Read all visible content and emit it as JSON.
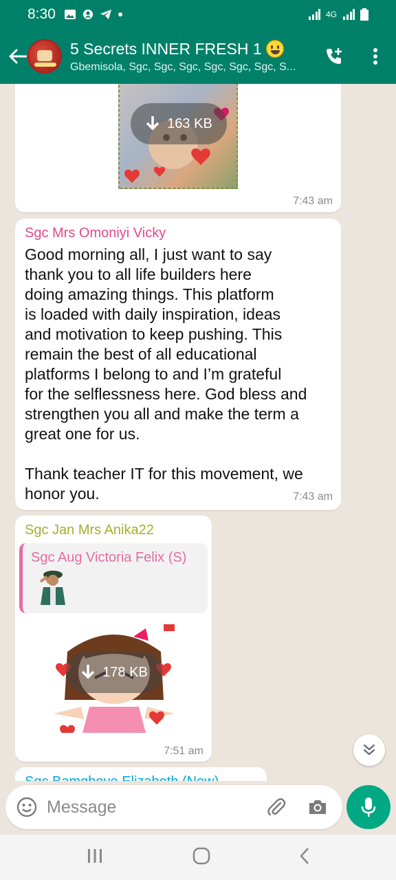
{
  "status_bar": {
    "time": "8:30",
    "network": "4G"
  },
  "header": {
    "title": "5 Secrets INNER FRESH 1",
    "subtitle": "Gbemisola, Sgc, Sgc, Sgc, Sgc, Sgc, Sgc, S...",
    "colors": {
      "bar": "#008069",
      "accent": "#00a884"
    }
  },
  "messages": [
    {
      "type": "image",
      "download_size": "163 KB",
      "time": "7:43 am"
    },
    {
      "type": "text",
      "sender": "Sgc Mrs Omoniyi Vicky",
      "sender_color": "#e2498c",
      "text": "Good morning all, I just want to say\nthank you to all life builders here\ndoing amazing things. This platform\nis loaded with daily inspiration, ideas\nand motivation to keep pushing. This\nremain the best of all educational\nplatforms I belong to and I’m grateful\nfor the selflessness here. God bless and\nstrengthen you all and make the term a\ngreat one for us.\n\nThank teacher IT for this movement, we\nhonor you.",
      "time": "7:43 am"
    },
    {
      "type": "sticker_reply",
      "sender": "Sgc Jan Mrs Anika22",
      "sender_color": "#a3b02b",
      "quoted_sender": "Sgc Aug Victoria Felix (S)",
      "quoted_color": "#e56ca0",
      "download_size": "178 KB",
      "time": "7:51 am"
    },
    {
      "type": "partial",
      "sender": "Sgc Bamgboye Elizabeth (New)",
      "sender_color": "#00a8d6"
    }
  ],
  "input": {
    "placeholder": "Message"
  }
}
